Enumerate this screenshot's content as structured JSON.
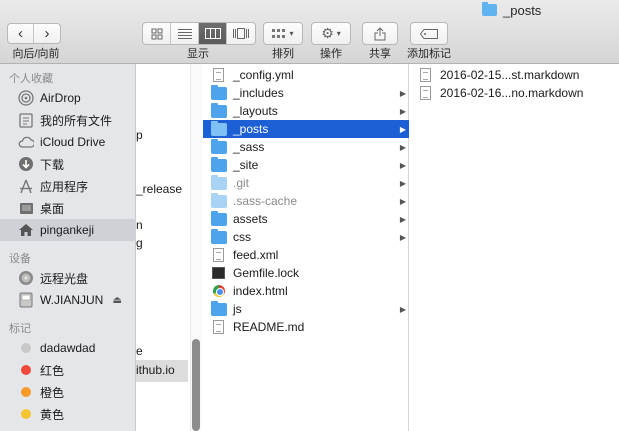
{
  "window": {
    "title": "_posts"
  },
  "toolbar": {
    "nav_back": "‹",
    "nav_forward": "›",
    "nav_label": "向后/向前",
    "view_label": "显示",
    "arrange_label": "排列",
    "action_label": "操作",
    "share_label": "共享",
    "tags_label": "添加标记"
  },
  "sidebar": {
    "favorites_header": "个人收藏",
    "favorites": [
      {
        "label": "AirDrop",
        "icon": "airdrop-icon"
      },
      {
        "label": "我的所有文件",
        "icon": "all-files-icon"
      },
      {
        "label": "iCloud Drive",
        "icon": "cloud-icon"
      },
      {
        "label": "下载",
        "icon": "download-icon"
      },
      {
        "label": "应用程序",
        "icon": "applications-icon"
      },
      {
        "label": "桌面",
        "icon": "desktop-icon"
      },
      {
        "label": "pingankeji",
        "icon": "home-icon"
      }
    ],
    "devices_header": "设备",
    "devices": [
      {
        "label": "远程光盘",
        "icon": "remote-disc-icon"
      },
      {
        "label": "W.JIANJUN",
        "icon": "drive-icon"
      }
    ],
    "tags_header": "标记",
    "tags": [
      {
        "label": "dadawdad",
        "color": "#c8c8c8"
      },
      {
        "label": "红色",
        "color": "#f0493e"
      },
      {
        "label": "橙色",
        "color": "#f79a2a"
      },
      {
        "label": "黄色",
        "color": "#f5c431"
      }
    ]
  },
  "column1": {
    "fragments": [
      {
        "text": "p"
      },
      {
        "text": "_release"
      },
      {
        "text": "n"
      },
      {
        "text": "g"
      },
      {
        "text": "e"
      },
      {
        "text": "ithub.io"
      }
    ]
  },
  "column2": {
    "items": [
      {
        "name": "_config.yml",
        "type": "doc",
        "folder": false
      },
      {
        "name": "_includes",
        "type": "folder",
        "folder": true
      },
      {
        "name": "_layouts",
        "type": "folder",
        "folder": true
      },
      {
        "name": "_posts",
        "type": "folder",
        "folder": true,
        "selected": true
      },
      {
        "name": "_sass",
        "type": "folder",
        "folder": true
      },
      {
        "name": "_site",
        "type": "folder",
        "folder": true
      },
      {
        "name": ".git",
        "type": "folder-light",
        "folder": true,
        "dim": true
      },
      {
        "name": ".sass-cache",
        "type": "folder-light",
        "folder": true,
        "dim": true
      },
      {
        "name": "assets",
        "type": "folder",
        "folder": true
      },
      {
        "name": "css",
        "type": "folder",
        "folder": true
      },
      {
        "name": "feed.xml",
        "type": "doc",
        "folder": false
      },
      {
        "name": "Gemfile.lock",
        "type": "term",
        "folder": false
      },
      {
        "name": "index.html",
        "type": "chrome",
        "folder": false
      },
      {
        "name": "js",
        "type": "folder",
        "folder": true
      },
      {
        "name": "README.md",
        "type": "doc",
        "folder": false
      }
    ]
  },
  "column3": {
    "items": [
      {
        "name": "2016-02-15...st.markdown"
      },
      {
        "name": "2016-02-16...no.markdown"
      }
    ]
  }
}
